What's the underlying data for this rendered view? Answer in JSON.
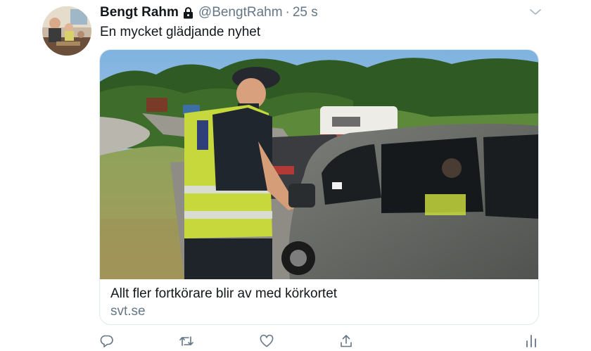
{
  "tweet": {
    "author_name": "Bengt Rahm",
    "handle": "@BengtRahm",
    "separator": "·",
    "timestamp": "25 s",
    "text": "En mycket glädjande nyhet"
  },
  "card": {
    "title": "Allt fler fortkörare blir av med körkortet",
    "domain": "svt.se"
  },
  "icons": {
    "lock": "lock-icon",
    "caret": "chevron-down-icon",
    "reply": "reply-icon",
    "retweet": "retweet-icon",
    "like": "heart-icon",
    "share": "share-icon",
    "analytics": "analytics-icon"
  },
  "colors": {
    "text_primary": "#14171a",
    "text_secondary": "#657786",
    "border": "#e1e8ed"
  }
}
